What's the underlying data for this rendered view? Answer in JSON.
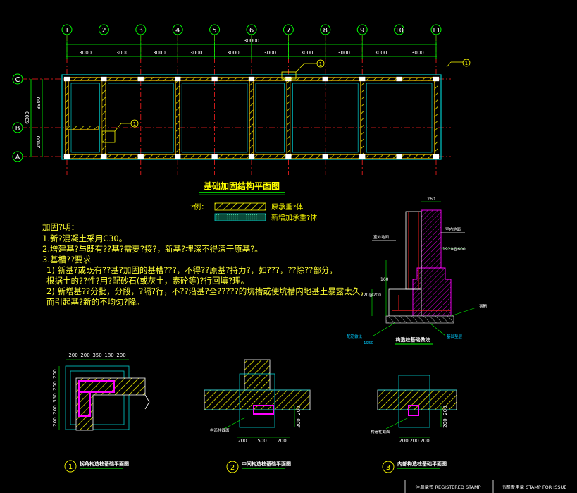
{
  "main_plan": {
    "title": "基础加固结构平面图",
    "column_axes": [
      "1",
      "2",
      "3",
      "4",
      "5",
      "6",
      "7",
      "8",
      "9",
      "10",
      "11"
    ],
    "row_axes": [
      "C",
      "B",
      "A"
    ],
    "bay_dims": [
      "3000",
      "3000",
      "3000",
      "3000",
      "3000",
      "3000",
      "3000",
      "3000",
      "3000",
      "3000"
    ],
    "total_dim": "30000",
    "row_dims": [
      "3900",
      "2400"
    ],
    "row_total_dim": "6300",
    "callout_top_right": "1",
    "callout_top_mid": "1",
    "callout_mid": "1"
  },
  "legend": {
    "label": "?例：",
    "items": [
      "原承重?体",
      "新增加承重?体"
    ]
  },
  "notes": {
    "heading": "加固?明：",
    "lines": [
      "1.新?混凝土采用C30。",
      "2.增建基?与既有??基?需要?接?，新基?埋深不得深于原基?。",
      "3.基槽??要求",
      "1)  新基?或既有??基?加固的基槽???，不得??原基?持力?，如???，??除??部分，",
      "     根据土的??性?用?配砂石(或灰土，素砼等)?行回填?理。",
      "2)  新增基??分批，分段，?隔?行，不??沿基?全?????的坑槽或使坑槽内地基土暴露太久，",
      "     而引起基?新的不均匀?降。"
    ]
  },
  "section_detail": {
    "caption": "构造柱基础做法",
    "dim_labels": [
      "260",
      "210",
      "1920@600",
      "160",
      "720@200",
      "1950"
    ],
    "annotation_labels": [
      "室外地面",
      "室内地面",
      "原墙",
      "原基础墙",
      "新增基础",
      "配筋做法",
      "钢筋",
      "基础垫层"
    ]
  },
  "details": [
    {
      "num": "1",
      "caption": "拐角构造柱基础平面图",
      "dims_top": [
        "200",
        "200",
        "350",
        "180",
        "200"
      ],
      "dims_left": [
        "200",
        "200",
        "350",
        "200",
        "200"
      ]
    },
    {
      "num": "2",
      "caption": "中间构造柱基础平面图",
      "dims_bottom": [
        "200",
        "500",
        "200"
      ],
      "dims_right": [
        "200",
        "200"
      ],
      "label": "构造柱截面"
    },
    {
      "num": "3",
      "caption": "内部构造柱基础平面图",
      "dims_bottom": [
        "200",
        "200",
        "200"
      ],
      "dims_right": [
        "200",
        "200"
      ],
      "label": "构造柱截面"
    }
  ],
  "title_block": {
    "left": "注册章签 REGISTERED STAMP",
    "right": "出图专用章 STAMP FOR ISSUE"
  }
}
